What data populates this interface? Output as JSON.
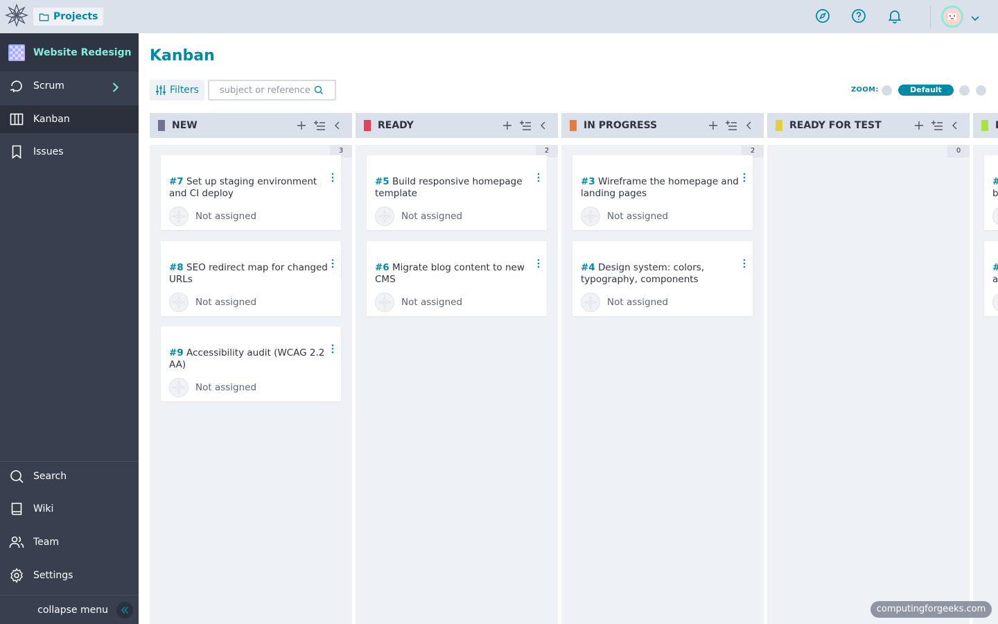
{
  "topbar": {
    "projects_label": "Projects",
    "icons": [
      "discover-icon",
      "help-icon",
      "notifications-icon"
    ],
    "accent": "#008aa8"
  },
  "sidebar": {
    "project_name": "Website Redesign",
    "items": [
      {
        "label": "Scrum",
        "icon": "scrum-icon"
      },
      {
        "label": "Kanban",
        "icon": "kanban-icon",
        "active": true
      },
      {
        "label": "Issues",
        "icon": "issues-icon"
      }
    ],
    "bottom_items": [
      {
        "label": "Search",
        "icon": "search-icon"
      },
      {
        "label": "Wiki",
        "icon": "wiki-icon"
      },
      {
        "label": "Team",
        "icon": "team-icon"
      },
      {
        "label": "Settings",
        "icon": "settings-icon"
      }
    ],
    "collapse_label": "collapse menu"
  },
  "main": {
    "title": "Kanban",
    "filters_label": "Filters",
    "search_placeholder": "subject or reference",
    "zoom_label": "ZOOM:",
    "zoom_default": "Default"
  },
  "columns": [
    {
      "name": "NEW",
      "color": "#70728f",
      "count": "3",
      "cards": [
        {
          "ref": "#7",
          "title": "Set up staging environment and CI deploy",
          "assignee": "Not assigned"
        },
        {
          "ref": "#8",
          "title": "SEO redirect map for changed URLs",
          "assignee": "Not assigned"
        },
        {
          "ref": "#9",
          "title": "Accessibility audit (WCAG 2.2 AA)",
          "assignee": "Not assigned"
        }
      ]
    },
    {
      "name": "READY",
      "color": "#e44057",
      "count": "2",
      "cards": [
        {
          "ref": "#5",
          "title": "Build responsive homepage template",
          "assignee": "Not assigned"
        },
        {
          "ref": "#6",
          "title": "Migrate blog content to new CMS",
          "assignee": "Not assigned"
        }
      ]
    },
    {
      "name": "IN PROGRESS",
      "color": "#e47c40",
      "count": "2",
      "cards": [
        {
          "ref": "#3",
          "title": "Wireframe the homepage and landing pages",
          "assignee": "Not assigned"
        },
        {
          "ref": "#4",
          "title": "Design system: colors, typography, components",
          "assignee": "Not assigned"
        }
      ]
    },
    {
      "name": "READY FOR TEST",
      "color": "#e4ce40",
      "count": "0",
      "cards": []
    },
    {
      "name": "D",
      "color": "#a8e440",
      "count": "",
      "cards": [
        {
          "ref": "#",
          "title": "b",
          "assignee": ""
        },
        {
          "ref": "#",
          "title": "a",
          "assignee": ""
        }
      ]
    }
  ],
  "watermark": "computingforgeeks.com"
}
